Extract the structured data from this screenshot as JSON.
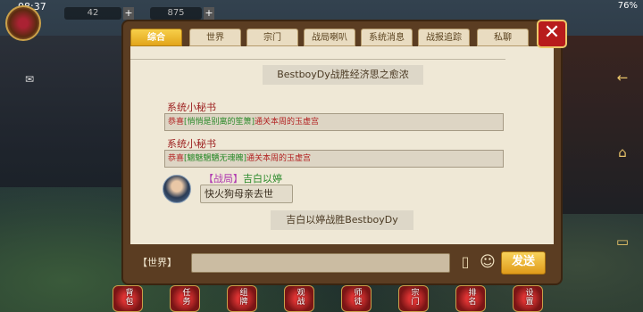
{
  "status_bar": {
    "time": "08:37",
    "battery": "76%"
  },
  "resources": [
    {
      "value": "42",
      "plus": "+"
    },
    {
      "value": "875",
      "plus": "+"
    }
  ],
  "tabs": [
    {
      "label": "综合",
      "active": true
    },
    {
      "label": "世界",
      "active": false
    },
    {
      "label": "宗门",
      "active": false
    },
    {
      "label": "战局喇叭",
      "active": false
    },
    {
      "label": "系统消息",
      "active": false
    },
    {
      "label": "战报追踪",
      "active": false
    },
    {
      "label": "私聊",
      "active": false
    }
  ],
  "close": "✕",
  "messages": {
    "battle_1": "BestboyDy战胜经济思之愈浓",
    "sys1": {
      "sender": "系统小秘书",
      "prefix": "恭喜",
      "team": "[悄悄是别离的笙箫]",
      "suffix": "通关本周的玉虚宫"
    },
    "sys2": {
      "sender": "系统小秘书",
      "prefix": "恭喜",
      "team": "[魑魅魍魉无魂魄]",
      "suffix": "通关本周的玉虚宫"
    },
    "chat": {
      "channel": "【战局】",
      "name": "吉白以婷",
      "text": "快火狗母亲去世"
    },
    "battle_2": "吉白以婷战胜BestboyDy"
  },
  "input_row": {
    "channel_label": "【世界】",
    "input_value": "",
    "send_label": "发送"
  },
  "bottom_nav": [
    {
      "label": "背包"
    },
    {
      "label": "任务"
    },
    {
      "label": "组牌"
    },
    {
      "label": "观战"
    },
    {
      "label": "师徒"
    },
    {
      "label": "宗门"
    },
    {
      "label": "排名"
    },
    {
      "label": "设置"
    }
  ],
  "icons": {
    "mail": "✉",
    "cards": "▯",
    "emoji": "☺"
  }
}
